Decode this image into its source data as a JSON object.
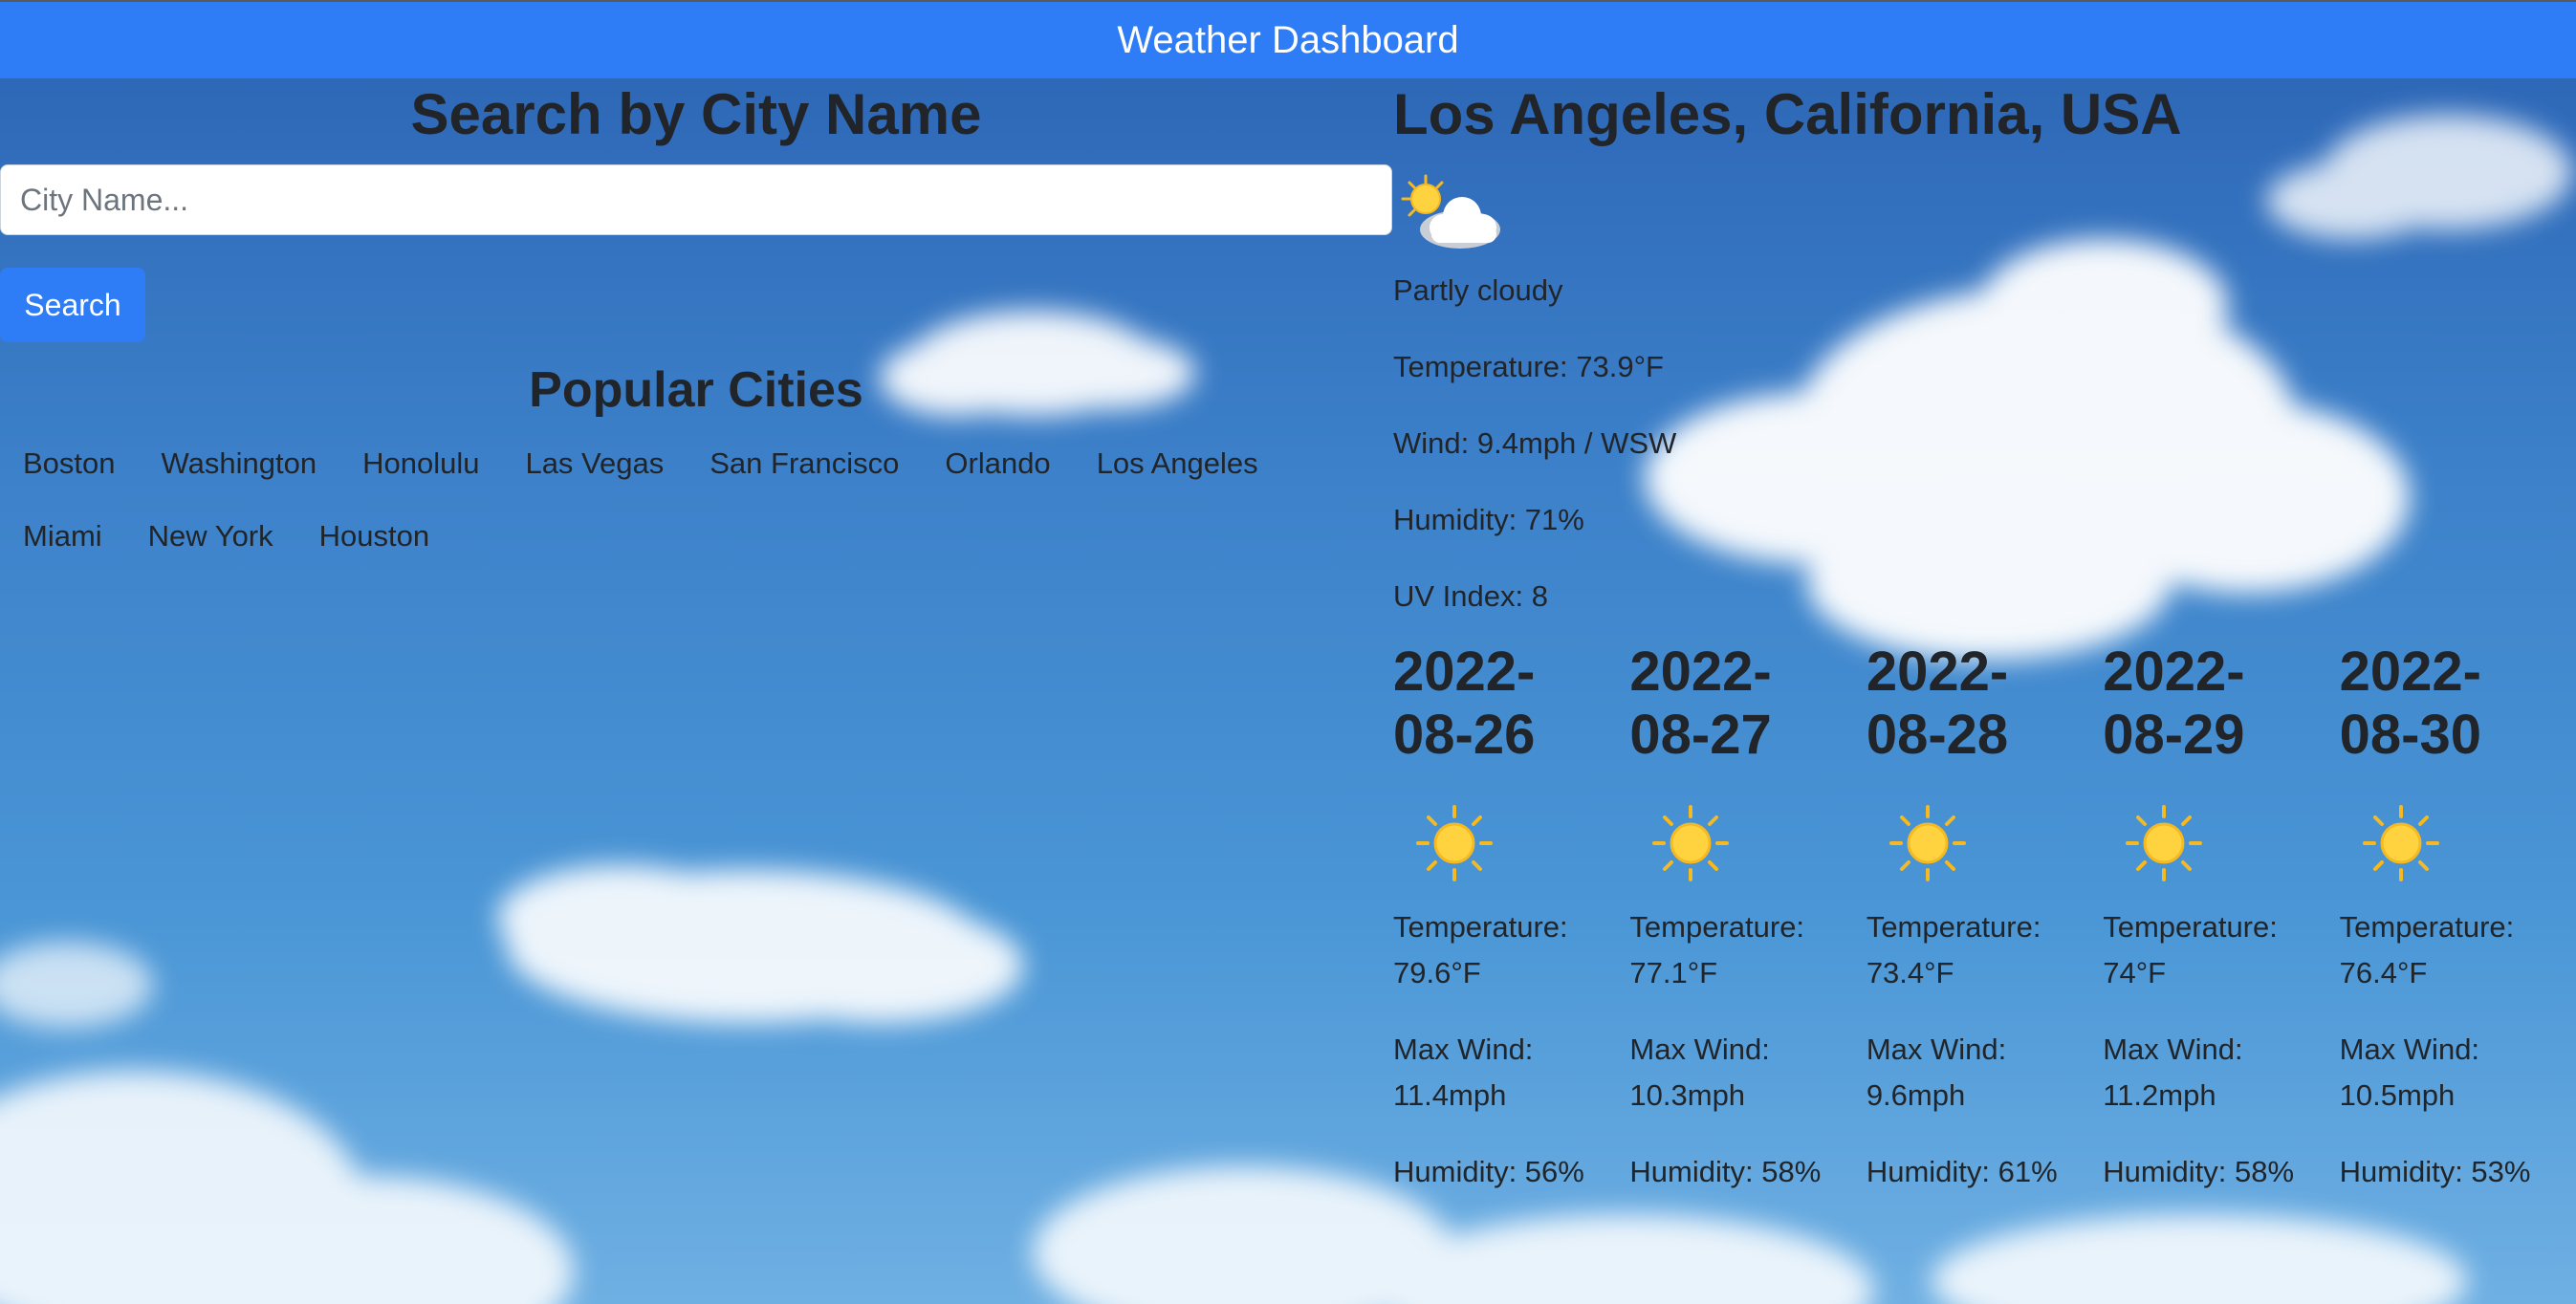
{
  "header": {
    "title": "Weather Dashboard"
  },
  "search": {
    "heading": "Search by City Name",
    "placeholder": "City Name...",
    "button_label": "Search"
  },
  "popular": {
    "heading": "Popular Cities",
    "cities": [
      "Boston",
      "Washington",
      "Honolulu",
      "Las Vegas",
      "San Francisco",
      "Orlando",
      "Los Angeles",
      "Miami",
      "New York",
      "Houston"
    ]
  },
  "current": {
    "location": "Los Angeles, California, USA",
    "icon": "partly-cloudy-icon",
    "condition": "Partly cloudy",
    "temperature": "Temperature: 73.9°F",
    "wind": "Wind: 9.4mph / WSW",
    "humidity": "Humidity: 71%",
    "uv": "UV Index: 8"
  },
  "forecast": [
    {
      "date": "2022-08-26",
      "icon": "sun-icon",
      "temp_label": "Temperature:",
      "temp": "79.6°F",
      "wind_label": "Max Wind:",
      "wind": "11.4mph",
      "humidity": "Humidity: 56%"
    },
    {
      "date": "2022-08-27",
      "icon": "sun-icon",
      "temp_label": "Temperature:",
      "temp": "77.1°F",
      "wind_label": "Max Wind:",
      "wind": "10.3mph",
      "humidity": "Humidity: 58%"
    },
    {
      "date": "2022-08-28",
      "icon": "sun-icon",
      "temp_label": "Temperature:",
      "temp": "73.4°F",
      "wind_label": "Max Wind:",
      "wind": "9.6mph",
      "humidity": "Humidity: 61%"
    },
    {
      "date": "2022-08-29",
      "icon": "sun-icon",
      "temp_label": "Temperature:",
      "temp": "74°F",
      "wind_label": "Max Wind:",
      "wind": "11.2mph",
      "humidity": "Humidity: 58%"
    },
    {
      "date": "2022-08-30",
      "icon": "sun-icon",
      "temp_label": "Temperature:",
      "temp": "76.4°F",
      "wind_label": "Max Wind:",
      "wind": "10.5mph",
      "humidity": "Humidity: 53%"
    }
  ],
  "colors": {
    "navbar": "#2e7cf6",
    "button": "#2e7cf6",
    "text": "#212529",
    "sky_top": "#2b63b4",
    "sky_bottom": "#6fb0e3"
  }
}
